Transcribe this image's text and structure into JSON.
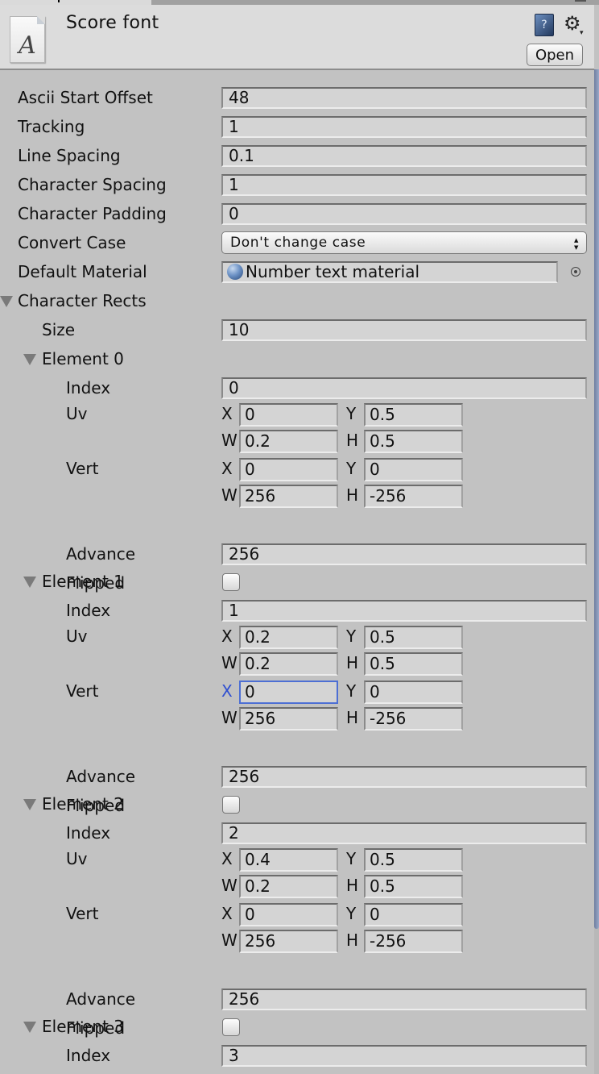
{
  "header": {
    "title": "Score font",
    "icon_glyph": "A",
    "help_icon_glyph": "?",
    "settings_icon_glyph": "⚙",
    "settings_caret": "▾",
    "open_button": "Open"
  },
  "properties": [
    {
      "label": "Ascii Start Offset",
      "value": "48"
    },
    {
      "label": "Tracking",
      "value": "1"
    },
    {
      "label": "Line Spacing",
      "value": "0.1"
    },
    {
      "label": "Character Spacing",
      "value": "1"
    },
    {
      "label": "Character Padding",
      "value": "0"
    }
  ],
  "convert_case": {
    "label": "Convert Case",
    "value": "Don't change case",
    "arrows": "▴▾"
  },
  "default_material": {
    "label": "Default Material",
    "value": "Number text material"
  },
  "character_rects": {
    "label": "Character Rects",
    "size_label": "Size",
    "size": "10",
    "sub_labels": {
      "index": "Index",
      "uv": "Uv",
      "vert": "Vert",
      "advance": "Advance",
      "flipped": "Flipped"
    },
    "axis": {
      "x": "X",
      "y": "Y",
      "w": "W",
      "h": "H"
    },
    "elements": [
      {
        "label": "Element 0",
        "index": "0",
        "uv": {
          "x": "0",
          "y": "0.5",
          "w": "0.2",
          "h": "0.5"
        },
        "vert": {
          "x": "0",
          "y": "0",
          "w": "256",
          "h": "-256"
        },
        "advance": "256",
        "flipped": false
      },
      {
        "label": "Element 1",
        "index": "1",
        "uv": {
          "x": "0.2",
          "y": "0.5",
          "w": "0.2",
          "h": "0.5"
        },
        "vert": {
          "x": "0",
          "y": "0",
          "w": "256",
          "h": "-256"
        },
        "advance": "256",
        "flipped": false,
        "focused_field": "vert.x"
      },
      {
        "label": "Element 2",
        "index": "2",
        "uv": {
          "x": "0.4",
          "y": "0.5",
          "w": "0.2",
          "h": "0.5"
        },
        "vert": {
          "x": "0",
          "y": "0",
          "w": "256",
          "h": "-256"
        },
        "advance": "256",
        "flipped": false
      },
      {
        "label": "Element 3",
        "index": "3"
      }
    ]
  },
  "colors": {
    "focus": "#4d6fd4",
    "panel_bg": "#c2c2c2",
    "header_bg": "#dcdcdc"
  }
}
